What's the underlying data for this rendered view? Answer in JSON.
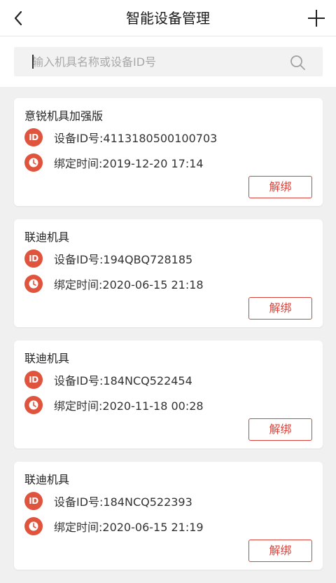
{
  "header": {
    "title": "智能设备管理",
    "back_icon": "chevron-left-icon",
    "add_icon": "plus-icon"
  },
  "search": {
    "placeholder": "输入机具名称或设备ID号",
    "icon": "search-icon"
  },
  "colors": {
    "accent": "#d9433a",
    "icon_bg": "#e0533c"
  },
  "devices": [
    {
      "name": "意锐机具加强版",
      "id_label": "设备ID号:4113180500100703",
      "time_label": "绑定时间:2019-12-20 17:14",
      "button": "解绑"
    },
    {
      "name": "联迪机具",
      "id_label": "设备ID号:194QBQ728185",
      "time_label": "绑定时间:2020-06-15 21:18",
      "button": "解绑"
    },
    {
      "name": "联迪机具",
      "id_label": "设备ID号:184NCQ522454",
      "time_label": "绑定时间:2020-11-18 00:28",
      "button": "解绑"
    },
    {
      "name": "联迪机具",
      "id_label": "设备ID号:184NCQ522393",
      "time_label": "绑定时间:2020-06-15 21:19",
      "button": "解绑"
    }
  ],
  "id_icon_text": "ID"
}
